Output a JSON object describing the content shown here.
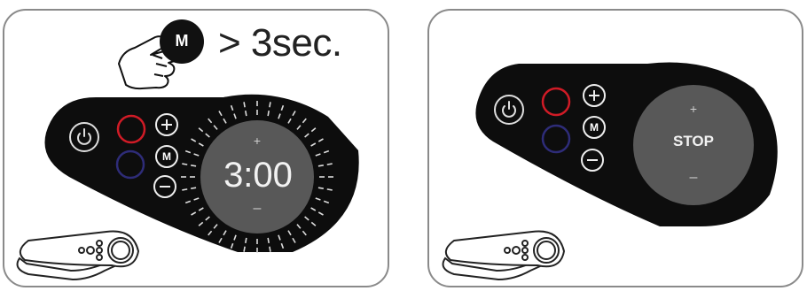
{
  "left_panel": {
    "instruction": "> 3sec.",
    "pressed_key": "M",
    "timer_display": "3:00",
    "controls": [
      "power-icon",
      "red-light",
      "blue-light",
      "plus-icon",
      "M",
      "minus-icon"
    ]
  },
  "right_panel": {
    "status_display": "STOP",
    "mode_key": "M",
    "controls": [
      "power-icon",
      "red-light",
      "blue-light",
      "plus-icon",
      "M",
      "minus-icon"
    ]
  },
  "colors": {
    "panel_body": "#0d0d0d",
    "dial": "#585858",
    "red_ring": "#d01b26",
    "blue_ring": "#2e2c78",
    "outline": "#8a8a8a"
  },
  "icons": [
    "hand-press-icon",
    "power-icon",
    "plus-icon",
    "minus-icon",
    "device-thumbnail-icon"
  ]
}
